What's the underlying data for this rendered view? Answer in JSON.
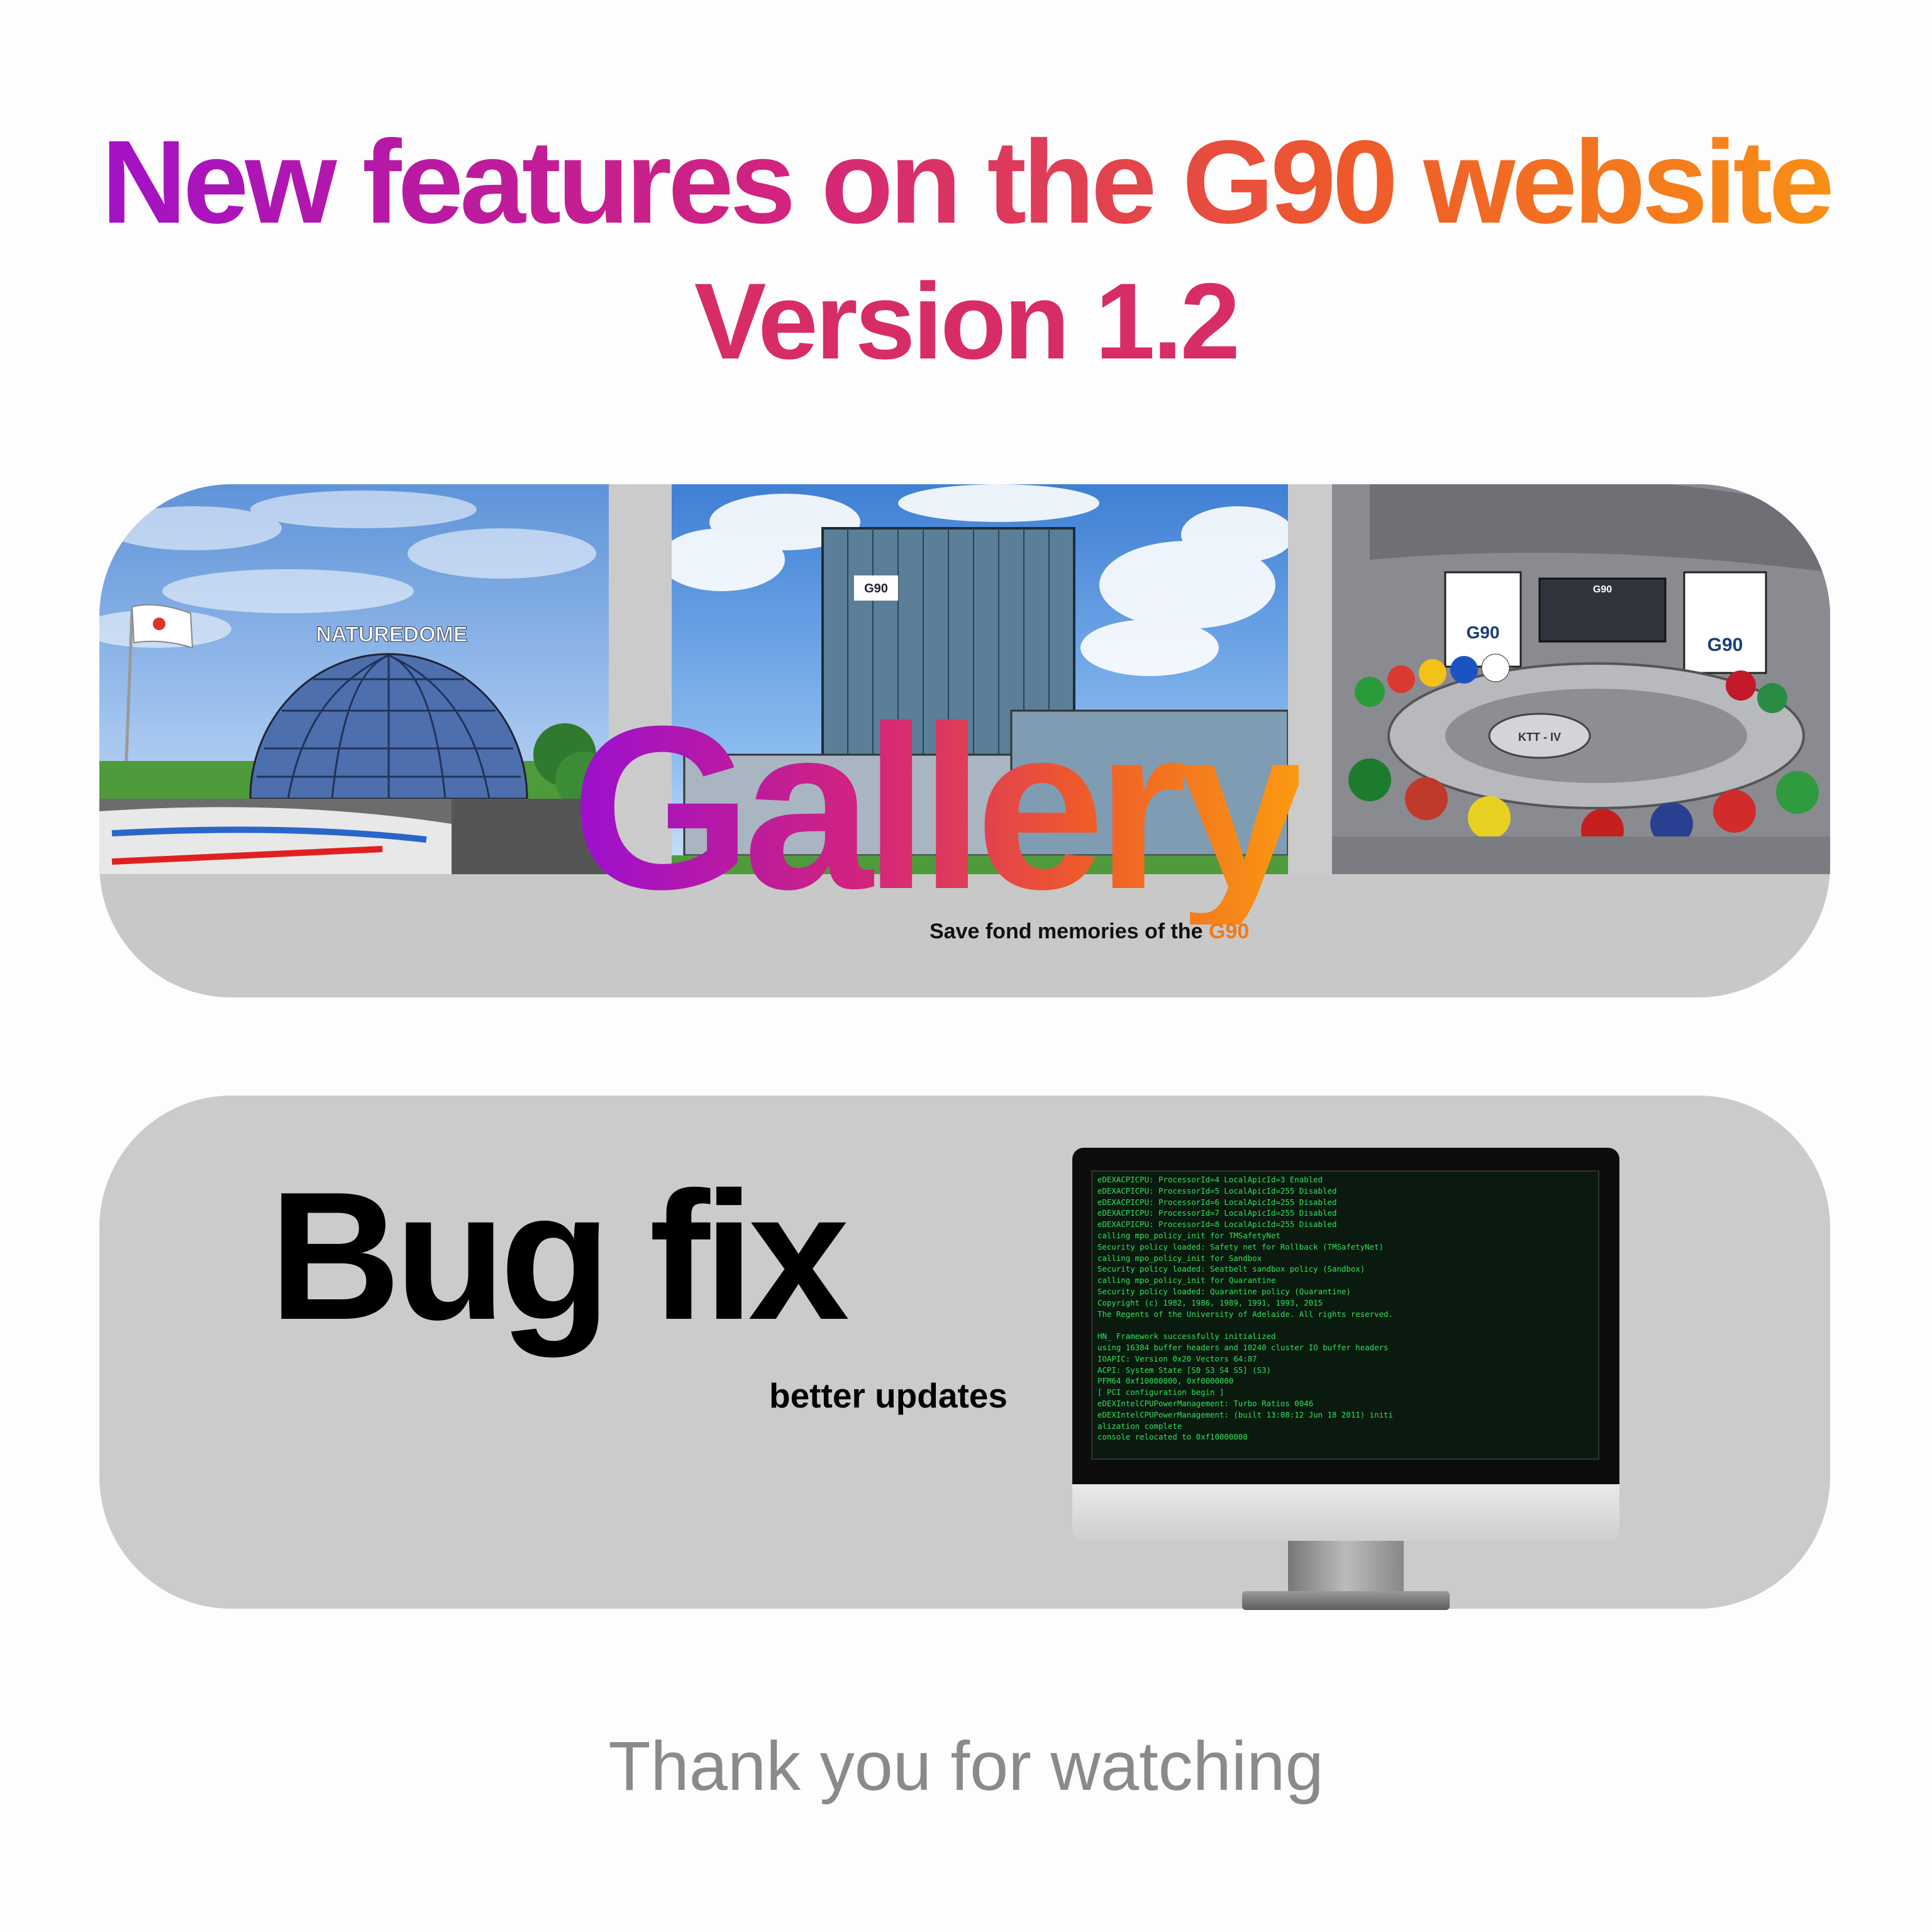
{
  "header": {
    "title": "New features on the G90 website",
    "version": "Version 1.2"
  },
  "gallery": {
    "heading": "Gallery",
    "subtitle_prefix": "Save fond memories of the ",
    "subtitle_highlight": "G90",
    "scenes": [
      {
        "sign": "NATUREDOME"
      },
      {
        "sign": "G90"
      },
      {
        "sign_left": "G90",
        "sign_center": "G90",
        "sign_right": "G90",
        "table_label": "KTT - IV"
      }
    ]
  },
  "bugfix": {
    "heading": "Bug fix",
    "subtitle": "better updates",
    "console_lines": [
      "eDEXACPICPU: ProcessorId=4 LocalApicId=3 Enabled",
      "eDEXACPICPU: ProcessorId=5 LocalApicId=255 Disabled",
      "eDEXACPICPU: ProcessorId=6 LocalApicId=255 Disabled",
      "eDEXACPICPU: ProcessorId=7 LocalApicId=255 Disabled",
      "eDEXACPICPU: ProcessorId=8 LocalApicId=255 Disabled",
      "calling mpo_policy_init for TMSafetyNet",
      "Security policy loaded: Safety net for Rollback (TMSafetyNet)",
      "calling mpo_policy_init for Sandbox",
      "Security policy loaded: Seatbelt sandbox policy (Sandbox)",
      "calling mpo_policy_init for Quarantine",
      "Security policy loaded: Quarantine policy (Quarantine)",
      "Copyright (c) 1982, 1986, 1989, 1991, 1993, 2015",
      "The Regents of the University of Adelaide. All rights reserved.",
      "",
      "HN_ Framework successfully initialized",
      "using 16384 buffer headers and 10240 cluster IO buffer headers",
      "IOAPIC: Version 0x20 Vectors 64:87",
      "ACPI: System State [S0 S3 S4 S5] (S3)",
      "PFM64 0xf10000000, 0xf0000000",
      "[ PCI configuration begin ]",
      "eDEXIntelCPUPowerManagement: Turbo Ratios 0046",
      "eDEXIntelCPUPowerManagement: (built 13:08:12 Jun 18 2011) initi",
      "alization complete",
      "console relocated to 0xf10000000"
    ]
  },
  "footer": {
    "thanks": "Thank you for watching"
  },
  "colors": {
    "gradient_start": "#9b0fd0",
    "gradient_mid": "#d2237e",
    "gradient_end": "#fb9a10",
    "panel": "#cbcbcb",
    "console_text": "#2fe25b",
    "footer_text": "#8a8a8a"
  }
}
